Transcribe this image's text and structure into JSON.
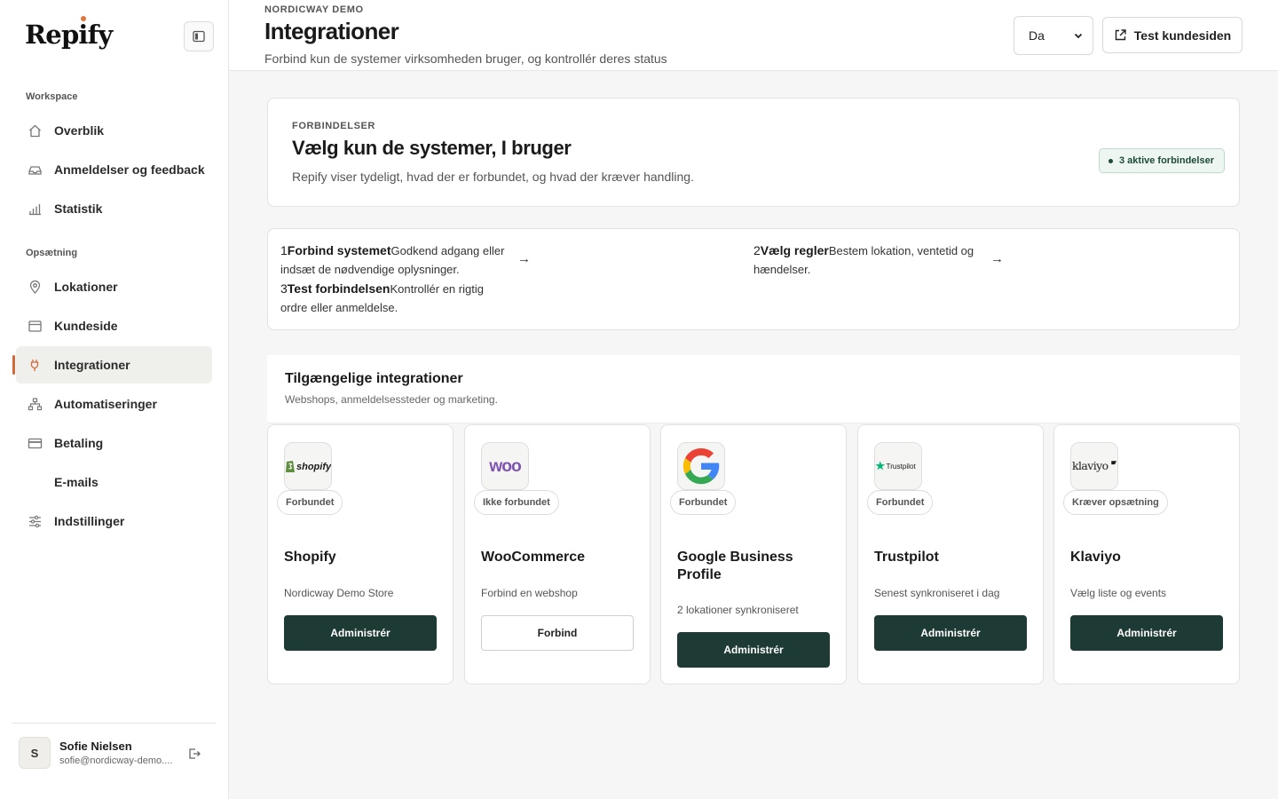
{
  "sidebar": {
    "brand": "Repify",
    "sections": [
      {
        "label": "Workspace"
      },
      {
        "label": "Opsætning"
      }
    ],
    "items": [
      {
        "label": "Overblik",
        "icon": "home-icon"
      },
      {
        "label": "Anmeldelser og feedback",
        "icon": "inbox-icon"
      },
      {
        "label": "Statistik",
        "icon": "bar-chart-icon"
      },
      {
        "label": "Lokationer",
        "icon": "map-pin-icon"
      },
      {
        "label": "Kundeside",
        "icon": "browser-window-icon"
      },
      {
        "label": "Integrationer",
        "icon": "plug-icon",
        "active": true
      },
      {
        "label": "Automatiseringer",
        "icon": "workflow-icon"
      },
      {
        "label": "Betaling",
        "icon": "credit-card-icon"
      },
      {
        "label": "E-mails",
        "icon": ""
      },
      {
        "label": "Indstillinger",
        "icon": "sliders-icon"
      }
    ],
    "user": {
      "initial": "S",
      "name": "Sofie Nielsen",
      "email": "sofie@nordicway-demo...."
    }
  },
  "header": {
    "eyebrow": "NORDICWAY DEMO",
    "title": "Integrationer",
    "subtitle": "Forbind kun de systemer virksomheden bruger, og kontrollér deres status",
    "language": "Da",
    "test_button": "Test kundesiden"
  },
  "connections": {
    "eyebrow": "FORBINDELSER",
    "title": "Vælg kun de systemer, I bruger",
    "description": "Repify viser tydeligt, hvad der er forbundet, og hvad der kræver handling.",
    "badge": "3 aktive forbindelser"
  },
  "steps": [
    {
      "num": "1",
      "title": "Forbind systemet",
      "text": "Godkend adgang eller indsæt de nødvendige oplysninger."
    },
    {
      "num": "2",
      "title": "Vælg regler",
      "text": "Bestem lokation, ventetid og hændelser."
    },
    {
      "num": "3",
      "title": "Test forbindelsen",
      "text": "Kontrollér en rigtig ordre eller anmeldelse."
    }
  ],
  "arrow": "→",
  "available": {
    "title": "Tilgængelige integrationer",
    "subtitle": "Webshops, anmeldelsessteder og marketing.",
    "integrations": [
      {
        "name": "Shopify",
        "logo": "shopify",
        "logo_text": "shopify",
        "status": "Forbundet",
        "description": "Nordicway Demo Store",
        "button": "Administrér",
        "primary": true
      },
      {
        "name": "WooCommerce",
        "logo": "woo",
        "logo_text": "woo",
        "status": "Ikke forbundet",
        "description": "Forbind en webshop",
        "button": "Forbind",
        "primary": false
      },
      {
        "name": "Google Business Profile",
        "logo": "google",
        "logo_text": "G",
        "status": "Forbundet",
        "description": "2 lokationer synkroniseret",
        "button": "Administrér",
        "primary": true
      },
      {
        "name": "Trustpilot",
        "logo": "trustpilot",
        "logo_text": "Trustpilot",
        "status": "Forbundet",
        "description": "Senest synkroniseret i dag",
        "button": "Administrér",
        "primary": true
      },
      {
        "name": "Klaviyo",
        "logo": "klaviyo",
        "logo_text": "klaviyo",
        "status": "Kræver opsætning",
        "description": "Vælg liste og events",
        "button": "Administrér",
        "primary": true
      }
    ]
  }
}
